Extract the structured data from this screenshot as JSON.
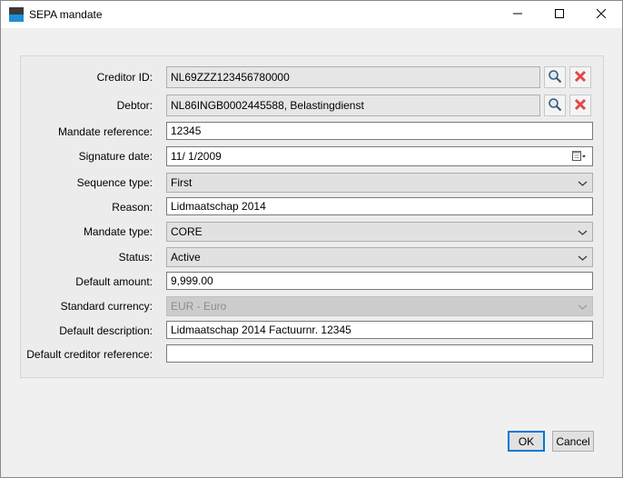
{
  "window": {
    "title": "SEPA mandate"
  },
  "icons": {
    "app": "app-window-icon",
    "minimize": "minimize-icon",
    "maximize": "maximize-icon",
    "close": "close-icon",
    "search": "magnifier-search-icon",
    "clear": "red-x-clear-icon",
    "dropdown": "chevron-down-icon",
    "calendar": "calendar-icon"
  },
  "colors": {
    "clear_red": "#e04a4a",
    "accent_blue": "#0078d7",
    "app_icon_dark": "#3a3a3a",
    "app_icon_blue": "#1e8fd6"
  },
  "form": {
    "creditor_id": {
      "label": "Creditor ID:",
      "value": "NL69ZZZ123456780000"
    },
    "debtor": {
      "label": "Debtor:",
      "value": "NL86INGB0002445588, Belastingdienst"
    },
    "mandate_reference": {
      "label": "Mandate reference:",
      "value": "12345"
    },
    "signature_date": {
      "label": "Signature date:",
      "value": "11/  1/2009"
    },
    "sequence_type": {
      "label": "Sequence type:",
      "value": "First"
    },
    "reason": {
      "label": "Reason:",
      "value": "Lidmaatschap 2014"
    },
    "mandate_type": {
      "label": "Mandate type:",
      "value": "CORE"
    },
    "status": {
      "label": "Status:",
      "value": "Active"
    },
    "default_amount": {
      "label": "Default amount:",
      "value": "9,999.00"
    },
    "standard_currency": {
      "label": "Standard currency:",
      "value": "EUR - Euro"
    },
    "default_description": {
      "label": "Default description:",
      "value": "Lidmaatschap 2014 Factuurnr. 12345"
    },
    "default_creditor_reference": {
      "label": "Default creditor reference:",
      "value": ""
    }
  },
  "buttons": {
    "ok": "OK",
    "cancel": "Cancel"
  }
}
